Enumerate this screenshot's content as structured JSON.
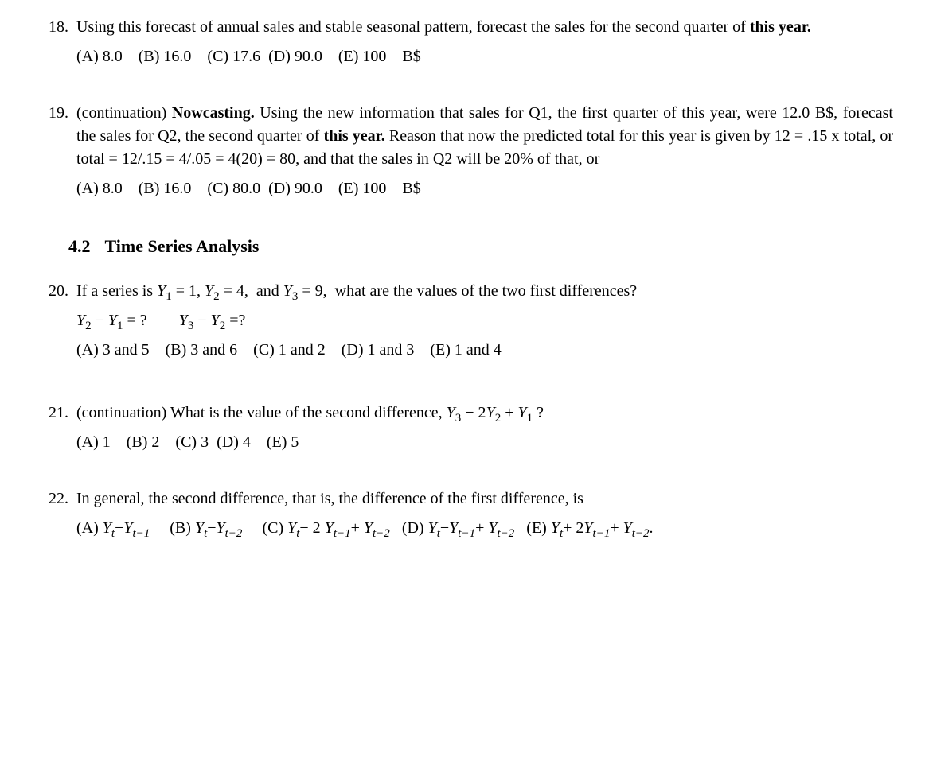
{
  "q18": {
    "num": "18.",
    "text_a": "Using this forecast of annual sales and stable seasonal pattern, forecast the sales for the second quarter of ",
    "text_b_bold": "this year.",
    "choices": "(A) 8.0 (B) 16.0 (C) 17.6 (D) 90.0 (E) 100 B$"
  },
  "q19": {
    "num": "19.",
    "text_a": "(continuation) ",
    "text_b_bold": "Nowcasting.",
    "text_c": " Using the new information that sales for Q1, the first quarter of this year, were 12.0 B$, forecast the sales for Q2, the second quarter of ",
    "text_d_bold": "this year.",
    "text_e": " Reason that now the predicted total for this year is given by 12 = .15 x total, or total = 12/.15 = 4/.05 = 4(20) = 80, and that the sales in Q2 will be 20% of that, or",
    "choices": "(A) 8.0 (B) 16.0 (C) 80.0 (D) 90.0 (E) 100 B$"
  },
  "section": {
    "num": "4.2",
    "title": "Time Series Analysis"
  },
  "q20": {
    "num": "20.",
    "text_before": "If a series is ",
    "y1": "Y",
    "y1sub": "1",
    "eq1": " = 1, ",
    "y2": "Y",
    "y2sub": "2",
    "eq2": " = 4, and ",
    "y3": "Y",
    "y3sub": "3",
    "eq3": " = 9, what are the values of the two first differences?",
    "d1a": "Y",
    "d1asub": "2",
    "d1m": " − ",
    "d1b": "Y",
    "d1bsub": "1",
    "d1e": "  = ?  ",
    "d2a": "Y",
    "d2asub": "3",
    "d2m": " − ",
    "d2b": "Y",
    "d2bsub": "2",
    "d2e": " =?",
    "choices": "(A) 3 and 5 (B) 3 and 6 (C) 1 and 2 (D) 1 and 3 (E) 1 and 4"
  },
  "q21": {
    "num": "21.",
    "text_a": "(continuation) What is the value of the second difference, ",
    "y3": "Y",
    "y3sub": "3",
    "m1": " − 2",
    "y2": "Y",
    "y2sub": "2",
    "m2": " + ",
    "y1": "Y",
    "y1sub": "1",
    "qmark": " ?",
    "choices": "(A) 1 (B) 2 (C) 3 (D) 4 (E) 5"
  },
  "q22": {
    "num": "22.",
    "text": "In general, the second difference, that is, the difference of the first difference, is",
    "cA_l": "(A) ",
    "cA_y1": "Y",
    "cA_y1s": "t",
    "cA_m1": "−",
    "cA_y2": "Y",
    "cA_y2s": "t−1",
    "cB_l": " (B) ",
    "cB_y1": "Y",
    "cB_y1s": "t",
    "cB_m1": "−",
    "cB_y2": "Y",
    "cB_y2s": "t−2",
    "cC_l": " (C) ",
    "cC_y1": "Y",
    "cC_y1s": "t",
    "cC_m1": "− 2",
    "cC_y2": "Y",
    "cC_y2s": "t−1",
    "cC_m2": "+ ",
    "cC_y3": "Y",
    "cC_y3s": "t−2",
    "cD_l": " (D) ",
    "cD_y1": "Y",
    "cD_y1s": "t",
    "cD_m1": "−",
    "cD_y2": "Y",
    "cD_y2s": "t−1",
    "cD_m2": "+ ",
    "cD_y3": "Y",
    "cD_y3s": "t−2",
    "cE_l": " (E) ",
    "cE_y1": "Y",
    "cE_y1s": "t",
    "cE_m1": "+ 2",
    "cE_y2": "Y",
    "cE_y2s": "t−1",
    "cE_m2": "+ ",
    "cE_y3": "Y",
    "cE_y3s": "t−2",
    "cE_end": "."
  }
}
